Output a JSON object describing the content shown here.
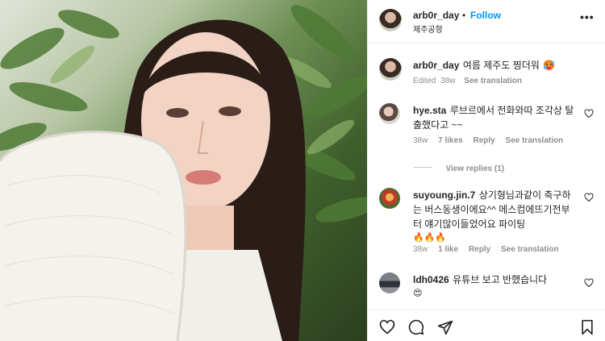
{
  "post": {
    "author": "arb0r_day",
    "dot": "•",
    "follow_label": "Follow",
    "location": "제주공항",
    "more_icon": "more-horizontal-icon",
    "photo_alt": "selfie photo"
  },
  "caption": {
    "author": "arb0r_day",
    "text": "여름 제주도 찡더워",
    "emoji": "🥵",
    "edited": "Edited",
    "time": "38w",
    "see_translation": "See translation"
  },
  "comments": [
    {
      "author": "hye.sta",
      "text": "루브르에서 전화와따 조각상 탈출했다고 ~~",
      "time": "38w",
      "likes": "7 likes",
      "reply": "Reply",
      "see_translation": "See translation",
      "view_replies": "View replies (1)"
    },
    {
      "author": "suyoung.jin.7",
      "text": "상기형님과같이 축구하는 버스동생이에요^^ 메스컴에뜨기전부터 얘기많이들었어요 파이팅",
      "emojis": "🔥🔥🔥",
      "time": "38w",
      "likes": "1 like",
      "reply": "Reply",
      "see_translation": "See translation"
    },
    {
      "author": "ldh0426",
      "text": "유튜브 보고 반했습니다",
      "emojis": "😍"
    }
  ],
  "colors": {
    "follow": "#0095f6",
    "muted": "#8e8e8e",
    "text": "#262626"
  },
  "footer_icons": [
    "heart-icon",
    "comment-icon",
    "share-icon",
    "bookmark-icon"
  ]
}
